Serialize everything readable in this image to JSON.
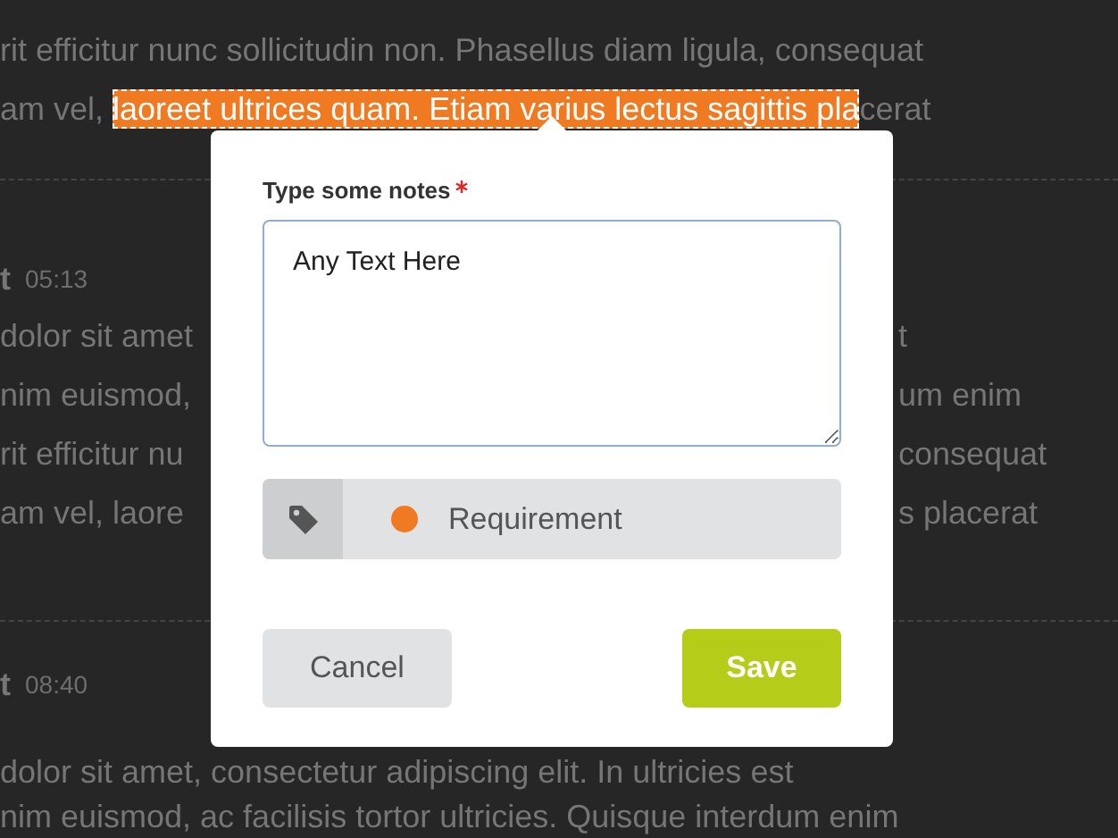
{
  "document": {
    "lines": [
      {
        "kind": "text",
        "left": "rit efficitur nunc sollicitudin non. Phasellus diam ligula, consequat"
      },
      {
        "kind": "highlight",
        "before": "am vel, ",
        "highlight": "laoreet ultrices quam. Etiam varius lectus sagittis pla",
        "after": "cerat"
      },
      {
        "kind": "divider"
      },
      {
        "kind": "meta",
        "author": "t",
        "time": "05:13"
      },
      {
        "kind": "text",
        "left": "dolor sit amet",
        "right": "t"
      },
      {
        "kind": "text",
        "left": "nim euismod,",
        "right": "um enim"
      },
      {
        "kind": "text",
        "left": "rit efficitur nu",
        "right": "consequat"
      },
      {
        "kind": "text",
        "left": "am vel, laore",
        "right": "s placerat"
      },
      {
        "kind": "divider"
      },
      {
        "kind": "meta",
        "author": "t",
        "time": "08:40"
      },
      {
        "kind": "text",
        "left": "dolor sit amet, consectetur adipiscing elit. In ultricies est"
      },
      {
        "kind": "text",
        "left": "nim euismod, ac facilisis tortor ultricies. Quisque interdum enim"
      }
    ]
  },
  "dialog": {
    "label": "Type some notes",
    "required": true,
    "value": "Any Text Here",
    "tag": {
      "label": "Requirement",
      "color": "#f07a22"
    },
    "buttons": [
      {
        "label": "Cancel",
        "kind": "secondary"
      },
      {
        "label": "Save",
        "kind": "primary"
      }
    ]
  }
}
